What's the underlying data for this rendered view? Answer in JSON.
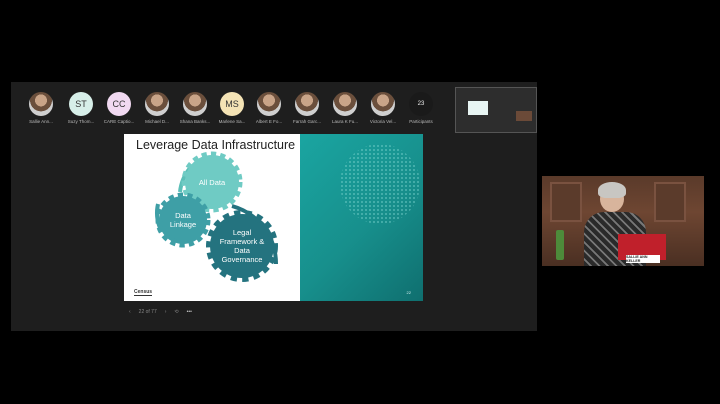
{
  "participants": [
    {
      "name": "Sallie Ann...",
      "initials": "",
      "photo": true
    },
    {
      "name": "Suzy Thom...",
      "initials": "ST",
      "color": "#d7efe9"
    },
    {
      "name": "CARE Captio...",
      "initials": "CC",
      "color": "#f1d9f1"
    },
    {
      "name": "Michael D...",
      "initials": "",
      "photo": true
    },
    {
      "name": "Shana Banks...",
      "initials": "",
      "photo": true
    },
    {
      "name": "Marlene Sa...",
      "initials": "MS",
      "color": "#f4e3b5"
    },
    {
      "name": "Albert E Fo...",
      "initials": "",
      "photo": true
    },
    {
      "name": "Farrah Garc...",
      "initials": "",
      "photo": true
    },
    {
      "name": "Laura K Fu...",
      "initials": "",
      "photo": true
    },
    {
      "name": "Victoria Vel...",
      "initials": "",
      "photo": true
    }
  ],
  "participants_button": {
    "count": "23",
    "label": "Participants"
  },
  "slide": {
    "title": "Leverage Data Infrastructure",
    "gear_all_data": "All Data",
    "gear_data_linkage": "Data Linkage",
    "gear_legal": "Legal Framework & Data Governance",
    "logo": "Census",
    "slide_number": "22"
  },
  "slide_nav": {
    "prev": "‹",
    "position": "22 of 77",
    "next": "›",
    "more": "•••"
  },
  "speaker": {
    "nameplate": "SALLIE ANN KELLER"
  },
  "colors": {
    "teal": "#1aa5a1",
    "gear_light": "#6fcbc4",
    "gear_mid": "#3e9fa6",
    "gear_dark": "#24737f"
  }
}
